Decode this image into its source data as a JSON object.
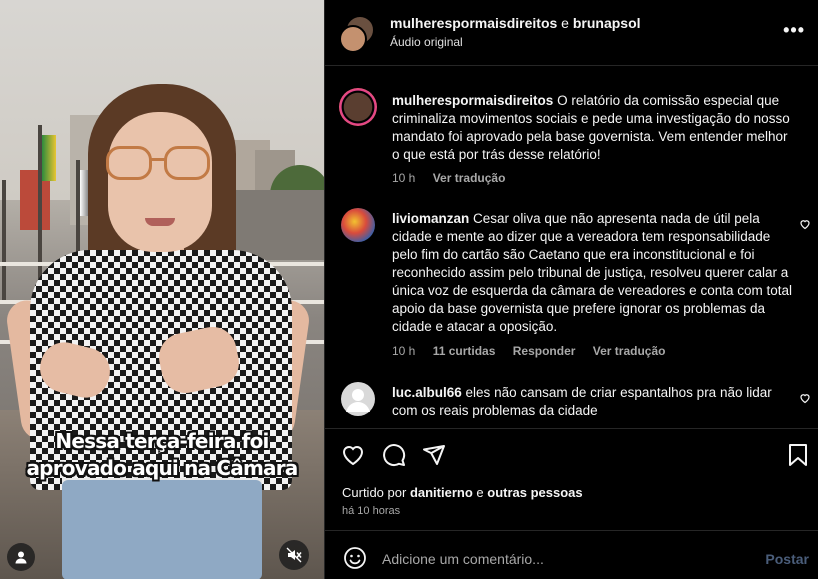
{
  "video": {
    "caption_line1": "Nessa terça-feira foi",
    "caption_line2": "aprovado aqui na Câmara",
    "user_icon": "person-icon",
    "mute_icon": "speaker-muted-icon"
  },
  "header": {
    "user1": "mulherespormaisdireitos",
    "conjunction": "e",
    "user2": "brunapsol",
    "audio": "Áudio original",
    "more_icon": "more-options-icon"
  },
  "caption_post": {
    "user": "mulherespormaisdireitos",
    "text": "O relatório da comissão especial que criminaliza movimentos sociais e pede uma investigação do nosso mandato foi aprovado pela base governista. Vem entender melhor o que está por trás desse relatório!",
    "time": "10 h",
    "translate": "Ver tradução"
  },
  "comments": [
    {
      "user": "liviomanzan",
      "text": "Cesar oliva que não apresenta nada de útil pela cidade e mente ao dizer que a vereadora tem responsabilidade pelo fim do cartão são Caetano que era inconstitucional e foi reconhecido assim pelo tribunal de justiça, resolveu querer calar a única voz de esquerda da câmara de vereadores e conta com total apoio da base governista que prefere ignorar os problemas da cidade e atacar a oposição.",
      "time": "10 h",
      "likes": "11 curtidas",
      "reply": "Responder",
      "translate": "Ver tradução"
    },
    {
      "user": "luc.albul66",
      "text": "eles não cansam de criar espantalhos pra não lidar com os reais problemas da cidade"
    }
  ],
  "actions": {
    "like_icon": "heart-icon",
    "comment_icon": "comment-icon",
    "share_icon": "share-icon",
    "save_icon": "bookmark-icon"
  },
  "likes": {
    "prefix": "Curtido por",
    "user": "danitierno",
    "conjunction": "e",
    "others": "outras pessoas"
  },
  "timestamp": "há 10 horas",
  "add_comment": {
    "placeholder": "Adicione um comentário...",
    "post": "Postar",
    "emoji_icon": "emoji-icon"
  },
  "colors": {
    "background": "#000000",
    "text": "#f5f5f5",
    "muted": "#a8a8a8",
    "divider": "#262626",
    "post_disabled": "#4a5d7a"
  }
}
